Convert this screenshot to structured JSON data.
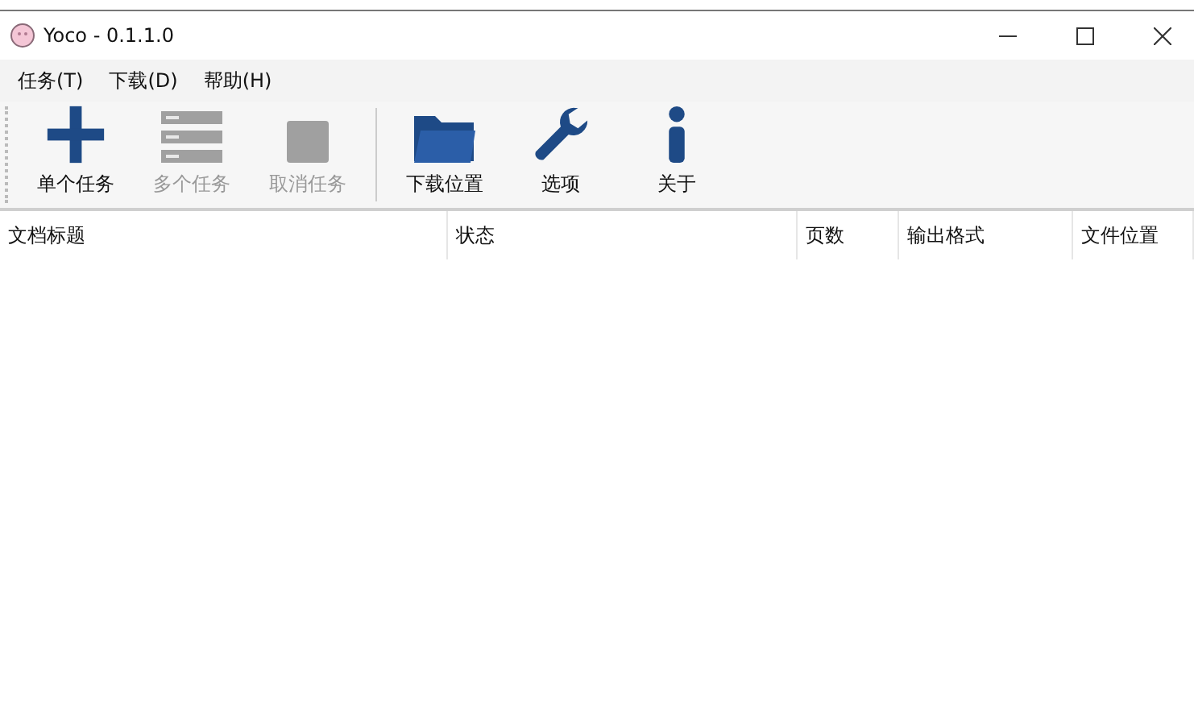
{
  "window": {
    "title": "Yoco - 0.1.1.0"
  },
  "menu": [
    "任务(T)",
    "下载(D)",
    "帮助(H)"
  ],
  "toolbar": [
    {
      "kind": "plus",
      "label": "单个任务",
      "disabled": false,
      "separator_before": false
    },
    {
      "kind": "list",
      "label": "多个任务",
      "disabled": true,
      "separator_before": false
    },
    {
      "kind": "stop",
      "label": "取消任务",
      "disabled": true,
      "separator_before": false
    },
    {
      "kind": "folder",
      "label": "下载位置",
      "disabled": false,
      "separator_before": true
    },
    {
      "kind": "wrench",
      "label": "选项",
      "disabled": false,
      "separator_before": false
    },
    {
      "kind": "info",
      "label": "关于",
      "disabled": false,
      "separator_before": false
    }
  ],
  "table": {
    "columns": [
      "文档标题",
      "状态",
      "页数",
      "输出格式",
      "文件位置"
    ]
  }
}
